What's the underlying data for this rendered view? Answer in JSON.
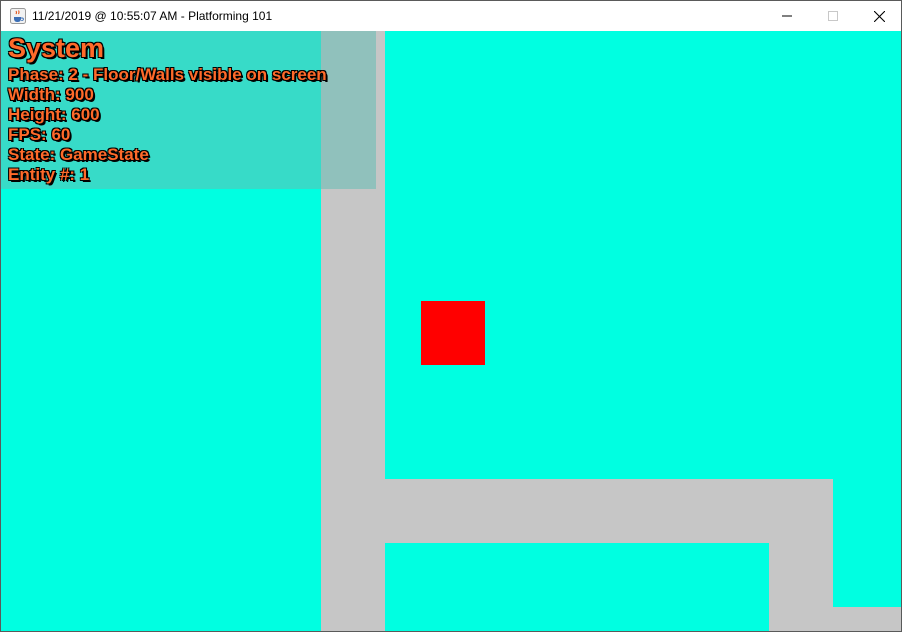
{
  "window": {
    "title": "11/21/2019 @ 10:55:07 AM - Platforming 101",
    "icon": "java-coffee-icon",
    "controls": [
      "minimize-icon",
      "maximize-icon",
      "close-icon"
    ]
  },
  "debug": {
    "title": "System",
    "lines": [
      "Phase: 2 - Floor/Walls visible on screen",
      "Width: 900",
      "Height: 600",
      "FPS: 60",
      "State: GameState",
      "Entity #: 1"
    ]
  },
  "colors": {
    "background": "#00ffe1",
    "wall": "#c6c6c6",
    "player": "#ff0000",
    "debug_text": "#ff6a2a"
  }
}
